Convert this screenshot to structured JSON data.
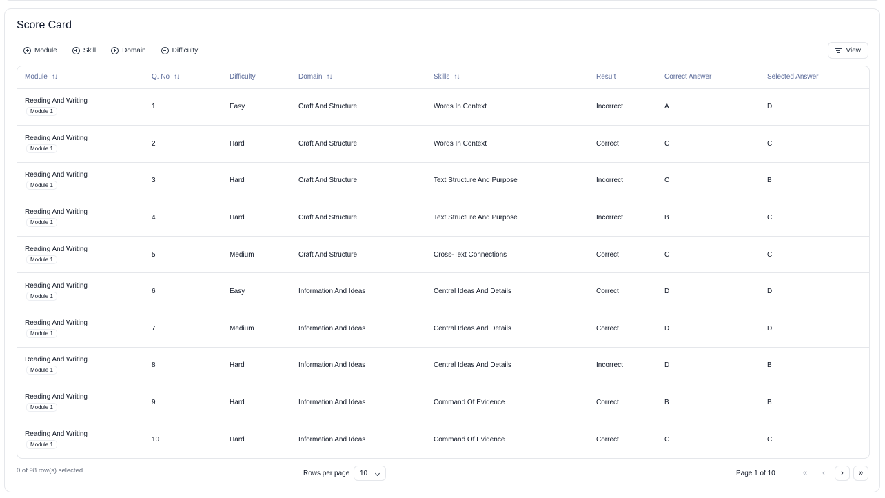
{
  "title": "Score Card",
  "filters": [
    {
      "label": "Module",
      "name": "module"
    },
    {
      "label": "Skill",
      "name": "skill"
    },
    {
      "label": "Domain",
      "name": "domain"
    },
    {
      "label": "Difficulty",
      "name": "difficulty"
    }
  ],
  "view_label": "View",
  "columns": [
    {
      "key": "module",
      "label": "Module",
      "sortable": true,
      "width": 184
    },
    {
      "key": "qno",
      "label": "Q. No",
      "sortable": true,
      "width": 113
    },
    {
      "key": "difficulty",
      "label": "Difficulty",
      "sortable": false,
      "width": 100
    },
    {
      "key": "domain",
      "label": "Domain",
      "sortable": true,
      "width": 196
    },
    {
      "key": "skill",
      "label": "Skills",
      "sortable": true,
      "width": 236
    },
    {
      "key": "result",
      "label": "Result",
      "sortable": false,
      "width": 99
    },
    {
      "key": "correct",
      "label": "Correct Answer",
      "sortable": false,
      "width": 149
    },
    {
      "key": "selected",
      "label": "Selected Answer",
      "sortable": false,
      "width": 161
    }
  ],
  "rows": [
    {
      "module": "Reading And Writing",
      "module_badge": "Module 1",
      "qno": "1",
      "difficulty": "Easy",
      "domain": "Craft And Structure",
      "skill": "Words In Context",
      "result": "Incorrect",
      "correct": "A",
      "selected": "D"
    },
    {
      "module": "Reading And Writing",
      "module_badge": "Module 1",
      "qno": "2",
      "difficulty": "Hard",
      "domain": "Craft And Structure",
      "skill": "Words In Context",
      "result": "Correct",
      "correct": "C",
      "selected": "C"
    },
    {
      "module": "Reading And Writing",
      "module_badge": "Module 1",
      "qno": "3",
      "difficulty": "Hard",
      "domain": "Craft And Structure",
      "skill": "Text Structure And Purpose",
      "result": "Incorrect",
      "correct": "C",
      "selected": "B"
    },
    {
      "module": "Reading And Writing",
      "module_badge": "Module 1",
      "qno": "4",
      "difficulty": "Hard",
      "domain": "Craft And Structure",
      "skill": "Text Structure And Purpose",
      "result": "Incorrect",
      "correct": "B",
      "selected": "C"
    },
    {
      "module": "Reading And Writing",
      "module_badge": "Module 1",
      "qno": "5",
      "difficulty": "Medium",
      "domain": "Craft And Structure",
      "skill": "Cross-Text Connections",
      "result": "Correct",
      "correct": "C",
      "selected": "C"
    },
    {
      "module": "Reading And Writing",
      "module_badge": "Module 1",
      "qno": "6",
      "difficulty": "Easy",
      "domain": "Information And Ideas",
      "skill": "Central Ideas And Details",
      "result": "Correct",
      "correct": "D",
      "selected": "D"
    },
    {
      "module": "Reading And Writing",
      "module_badge": "Module 1",
      "qno": "7",
      "difficulty": "Medium",
      "domain": "Information And Ideas",
      "skill": "Central Ideas And Details",
      "result": "Correct",
      "correct": "D",
      "selected": "D"
    },
    {
      "module": "Reading And Writing",
      "module_badge": "Module 1",
      "qno": "8",
      "difficulty": "Hard",
      "domain": "Information And Ideas",
      "skill": "Central Ideas And Details",
      "result": "Incorrect",
      "correct": "D",
      "selected": "B"
    },
    {
      "module": "Reading And Writing",
      "module_badge": "Module 1",
      "qno": "9",
      "difficulty": "Hard",
      "domain": "Information And Ideas",
      "skill": "Command Of Evidence",
      "result": "Correct",
      "correct": "B",
      "selected": "B"
    },
    {
      "module": "Reading And Writing",
      "module_badge": "Module 1",
      "qno": "10",
      "difficulty": "Hard",
      "domain": "Information And Ideas",
      "skill": "Command Of Evidence",
      "result": "Correct",
      "correct": "C",
      "selected": "C"
    }
  ],
  "footer": {
    "selection_text": "0 of 98 row(s) selected.",
    "rows_per_page_label": "Rows per page",
    "rows_per_page_value": "10",
    "page_info": "Page 1 of 10"
  },
  "pagination_icons": [
    {
      "name": "first-page",
      "glyph": "«",
      "enabled": false
    },
    {
      "name": "previous-page",
      "glyph": "‹",
      "enabled": false
    },
    {
      "name": "next-page",
      "glyph": "›",
      "enabled": true
    },
    {
      "name": "last-page",
      "glyph": "»",
      "enabled": true
    }
  ],
  "colors": {
    "header_text": "#5b6b9a",
    "border": "#e5e7eb"
  }
}
